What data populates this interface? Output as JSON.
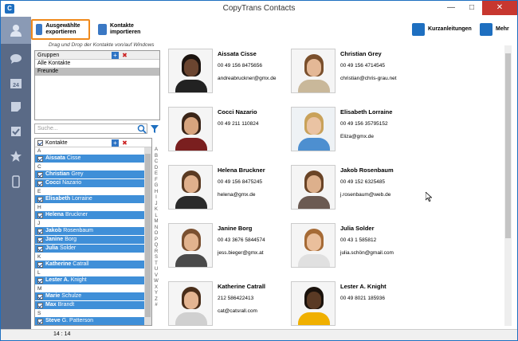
{
  "window": {
    "title": "CopyTrans Contacts"
  },
  "toolbar": {
    "export_selected": "Ausgewählte exportieren",
    "export_contacts": "Kontakte importieren",
    "quickguide": "Kurzanleitungen",
    "more": "Mehr"
  },
  "drag_hint": "Drag und Drop der Kontakte von/auf Windows",
  "groups": {
    "header": "Gruppen",
    "items": [
      "Alle Kontakte",
      "Freunde"
    ],
    "selected": "Freunde"
  },
  "search": {
    "placeholder": "Suche..."
  },
  "contact_list": {
    "header": "Kontakte",
    "sections": [
      {
        "letter": "A",
        "rows": [
          {
            "first": "Aissata",
            "last": "Cisse"
          }
        ]
      },
      {
        "letter": "C",
        "rows": [
          {
            "first": "Christian",
            "last": "Grey"
          },
          {
            "first": "Cocci",
            "last": "Nazario"
          }
        ]
      },
      {
        "letter": "E",
        "rows": [
          {
            "first": "Elisabeth",
            "last": "Lorraine"
          }
        ]
      },
      {
        "letter": "H",
        "rows": [
          {
            "first": "Helena",
            "last": "Bruckner"
          }
        ]
      },
      {
        "letter": "J",
        "rows": [
          {
            "first": "Jakob",
            "last": "Rosenbaum"
          },
          {
            "first": "Janine",
            "last": "Borg"
          },
          {
            "first": "Julia",
            "last": "Solder"
          }
        ]
      },
      {
        "letter": "K",
        "rows": [
          {
            "first": "Katherine",
            "last": "Catrall"
          }
        ]
      },
      {
        "letter": "L",
        "rows": [
          {
            "first": "Lester A.",
            "last": "Knight"
          }
        ]
      },
      {
        "letter": "M",
        "rows": [
          {
            "first": "Marie",
            "last": "Schulze"
          },
          {
            "first": "Max",
            "last": "Brandt"
          }
        ]
      },
      {
        "letter": "S",
        "rows": [
          {
            "first": "Steve",
            "last": "G. Patterson"
          }
        ]
      }
    ]
  },
  "alphabet": [
    "A",
    "B",
    "C",
    "D",
    "E",
    "F",
    "G",
    "H",
    "I",
    "J",
    "K",
    "L",
    "M",
    "N",
    "O",
    "P",
    "Q",
    "R",
    "S",
    "T",
    "U",
    "V",
    "W",
    "X",
    "Y",
    "Z",
    "#"
  ],
  "cards": [
    {
      "name": "Aissata Cisse",
      "phone": "00 49 156 8475656",
      "email": "andreabruckner@gmx.de",
      "skin": "#6b4530",
      "hair": "#1c1410",
      "shirt": "#222222",
      "bg": "#f5f5f5"
    },
    {
      "name": "Christian Grey",
      "phone": "00 49 156 4714545",
      "email": "christian@chris-grau.net",
      "skin": "#e4b896",
      "hair": "#7a4f2c",
      "shirt": "#c9b89a",
      "bg": "#f5f5f5"
    },
    {
      "name": "Cocci Nazario",
      "phone": "00 49 211 110824",
      "email": "",
      "skin": "#d7a47e",
      "hair": "#3a2518",
      "shirt": "#7a1f1f",
      "bg": "#f5f5f5"
    },
    {
      "name": "Elisabeth Lorraine",
      "phone": "00 49 156 35795152",
      "email": "Eliza@gmx.de",
      "skin": "#eac3a3",
      "hair": "#c9a25a",
      "shirt": "#4d8fd0",
      "bg": "#eef2f5"
    },
    {
      "name": "Helena Bruckner",
      "phone": "00 49 156 8475245",
      "email": "helena@gmx.de",
      "skin": "#e0b08c",
      "hair": "#5a3a22",
      "shirt": "#2a2a2a",
      "bg": "#f5f5f5"
    },
    {
      "name": "Jakob Rosenbaum",
      "phone": "00 49 152 6325485",
      "email": "j.rosenbaum@web.de",
      "skin": "#ddb08c",
      "hair": "#6a4426",
      "shirt": "#6b5a52",
      "bg": "#f5f5f5"
    },
    {
      "name": "Janine Borg",
      "phone": "00 43 3676 5844574",
      "email": "jess.bieger@gmx.at",
      "skin": "#e2b38e",
      "hair": "#7a5030",
      "shirt": "#4a4a4a",
      "bg": "#f5f5f5"
    },
    {
      "name": "Julia Solder",
      "phone": "00 43 1 585812",
      "email": "julia.schön@gmail.com",
      "skin": "#eabf9c",
      "hair": "#a66b36",
      "shirt": "#e0e0e0",
      "bg": "#f5f5f5"
    },
    {
      "name": "Katherine Catrall",
      "phone": "212 586422413",
      "email": "cat@catsrall.com",
      "skin": "#e4b592",
      "hair": "#4a2e1a",
      "shirt": "#d0d0d0",
      "bg": "#f5f5f5"
    },
    {
      "name": "Lester A. Knight",
      "phone": "00 49 8021 185936",
      "email": "",
      "skin": "#5a3a24",
      "hair": "#1a120c",
      "shirt": "#f0b000",
      "bg": "#f5f5f5"
    }
  ],
  "status": {
    "time": "14 : 14"
  }
}
